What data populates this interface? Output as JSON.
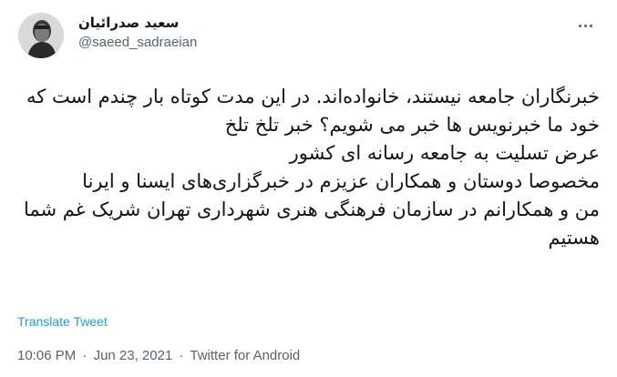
{
  "author": {
    "display_name": "سعید صدرائیان",
    "handle": "@saeed_sadraeian",
    "avatar": "profile-photo"
  },
  "menu": {
    "icon": "more-horizontal-icon"
  },
  "tweet": {
    "paragraphs": [
      "خبرنگاران جامعه نیستند، خانواده‌اند. در این مدت کوتاه بار چندم است که خود ما خبرنویس ها خبر می شویم؟ خبر تلخ تلخ",
      "عرض تسلیت به جامعه رسانه ای کشور",
      "مخصوصا دوستان و همکاران عزیزم در خبرگزاری‌های ایسنا و ایرنا",
      "من و همکارانم در سازمان فرهنگی هنری شهرداری تهران شریک غم شما هستیم"
    ]
  },
  "translate_label": "Translate Tweet",
  "meta": {
    "time": "10:06 PM",
    "date": "Jun 23, 2021",
    "source": "Twitter for Android",
    "separator": "·"
  },
  "colors": {
    "link": "#1d9bf0",
    "secondary_text": "#536471",
    "primary_text": "#0f1419"
  }
}
